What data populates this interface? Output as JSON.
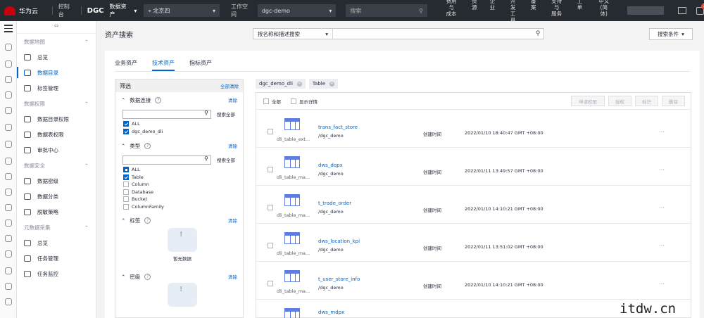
{
  "topbar": {
    "brand": "华为云",
    "console": "控制台",
    "product": "DGC",
    "module": "数据资产",
    "region": "北京四",
    "workspace_label": "工作空间",
    "workspace": "dgc-demo",
    "search_placeholder": "搜索",
    "menu": [
      "费用与\n成本",
      "资\n源",
      "企\n业",
      "开发\n工具",
      "备\n案",
      "支持与\n服务",
      "工\n单",
      "中文(简\n体)"
    ],
    "badge": "7"
  },
  "sidebar": {
    "sections": [
      {
        "title": "数据地图",
        "items": [
          {
            "label": "总览"
          },
          {
            "label": "数据目录"
          },
          {
            "label": "标签管理"
          }
        ]
      },
      {
        "title": "数据权限",
        "items": [
          {
            "label": "数据目录权限"
          },
          {
            "label": "数据表权限"
          },
          {
            "label": "审批中心"
          }
        ]
      },
      {
        "title": "数据安全",
        "items": [
          {
            "label": "数据密级"
          },
          {
            "label": "数据分类"
          },
          {
            "label": "脱敏策略"
          }
        ]
      },
      {
        "title": "元数据采集",
        "items": [
          {
            "label": "总览"
          },
          {
            "label": "任务管理"
          },
          {
            "label": "任务监控"
          }
        ]
      }
    ]
  },
  "page": {
    "title": "资产搜索",
    "search_scope": "按名称和描述搜索",
    "conditions_button": "搜索条件"
  },
  "tabs": [
    "业务资产",
    "技术资产",
    "指标资产"
  ],
  "filter": {
    "title": "筛选",
    "clear_all": "全部清除",
    "clear": "清除",
    "search_all": "搜索全部",
    "connection": {
      "title": "数据连接",
      "options": [
        "ALL",
        "dgc_demo_dli"
      ]
    },
    "type": {
      "title": "类型",
      "options": [
        "ALL",
        "Table",
        "Column",
        "Database",
        "Bucket",
        "ColumnFamily"
      ]
    },
    "tag": {
      "title": "标签",
      "empty": "暂无数据"
    },
    "level": {
      "title": "密级"
    }
  },
  "chips": [
    "dgc_demo_dli",
    "Table"
  ],
  "panel": {
    "select_all": "全部",
    "show_detail": "显示详情",
    "buttons": [
      "申请权限",
      "授权",
      "标识",
      "删除"
    ],
    "created_label": "创建时间",
    "rows": [
      {
        "type": "dli_table_ext...",
        "name": "trans_fact_store",
        "path": "/dgc_demo",
        "time": "2022/01/10 18:40:47 GMT +08:00"
      },
      {
        "type": "dli_table_ma...",
        "name": "dws_dqpx",
        "path": "/dgc_demo",
        "time": "2022/01/11 13:49:57 GMT +08:00"
      },
      {
        "type": "dli_table_ma...",
        "name": "t_trade_order",
        "path": "/dgc_demo",
        "time": "2022/01/10 14:10:21 GMT +08:00"
      },
      {
        "type": "dli_table_ma...",
        "name": "dws_location_kpi",
        "path": "/dgc_demo",
        "time": "2022/01/11 13:51:02 GMT +08:00"
      },
      {
        "type": "dli_table_ma...",
        "name": "t_user_store_info",
        "path": "/dgc_demo",
        "time": "2022/01/10 14:10:21 GMT +08:00"
      },
      {
        "type": "",
        "name": "dws_mdpx",
        "path": "",
        "time": ""
      }
    ],
    "more": "···"
  },
  "watermark": "itdw.cn"
}
